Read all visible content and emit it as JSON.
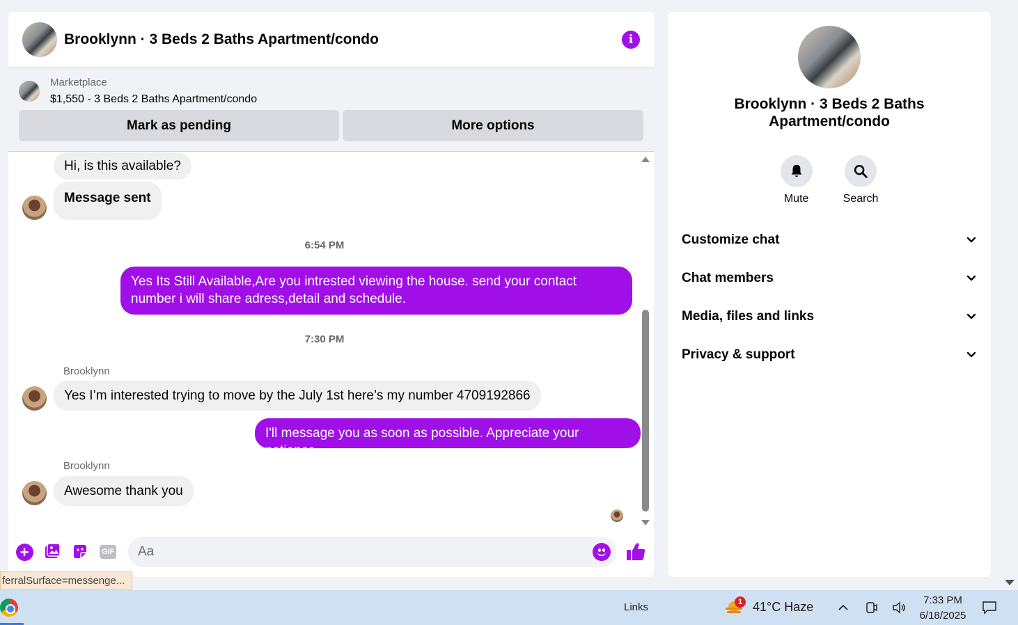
{
  "header": {
    "title": "Brooklynn · 3 Beds 2 Baths Apartment/condo",
    "info_icon": "info-icon"
  },
  "marketplace": {
    "label": "Marketplace",
    "listing": "$1,550 - 3 Beds 2 Baths Apartment/condo",
    "pending_button": "Mark as pending",
    "more_button": "More options"
  },
  "messages": [
    {
      "side": "in",
      "text": "Hi, is this available?"
    },
    {
      "side": "in",
      "text": "Message sent"
    },
    {
      "type": "timestamp",
      "text": "6:54 PM"
    },
    {
      "side": "out",
      "text": "Yes Its Still Available,Are you intrested viewing the house. send your contact number i will share adress,detail and schedule."
    },
    {
      "type": "timestamp",
      "text": "7:30 PM"
    },
    {
      "type": "sender",
      "text": "Brooklynn"
    },
    {
      "side": "in",
      "text": "Yes I’m interested trying to move by the July 1st here’s my number 4709192866"
    },
    {
      "side": "out",
      "text": "I'll message you as soon as possible. Appreciate your patience"
    },
    {
      "type": "sender",
      "text": "Brooklynn"
    },
    {
      "side": "in",
      "text": "Awesome thank you"
    }
  ],
  "composer": {
    "placeholder": "Aa",
    "gif_label": "GIF"
  },
  "info_panel": {
    "title": "Brooklynn · 3 Beds 2 Baths Apartment/condo",
    "actions": [
      {
        "label": "Mute",
        "icon": "bell-icon"
      },
      {
        "label": "Search",
        "icon": "search-icon"
      }
    ],
    "sections": [
      "Customize chat",
      "Chat members",
      "Media, files and links",
      "Privacy & support"
    ]
  },
  "status_tooltip": "ferralSurface=messenge...",
  "taskbar": {
    "links": "Links",
    "weather_badge": "1",
    "weather": "41°C  Haze",
    "time": "7:33 PM",
    "date": "6/18/2025"
  },
  "colors": {
    "accent": "#a30fe8",
    "outgoing_bubble": "#a00fe8",
    "incoming_bubble": "#f0f0f0"
  }
}
